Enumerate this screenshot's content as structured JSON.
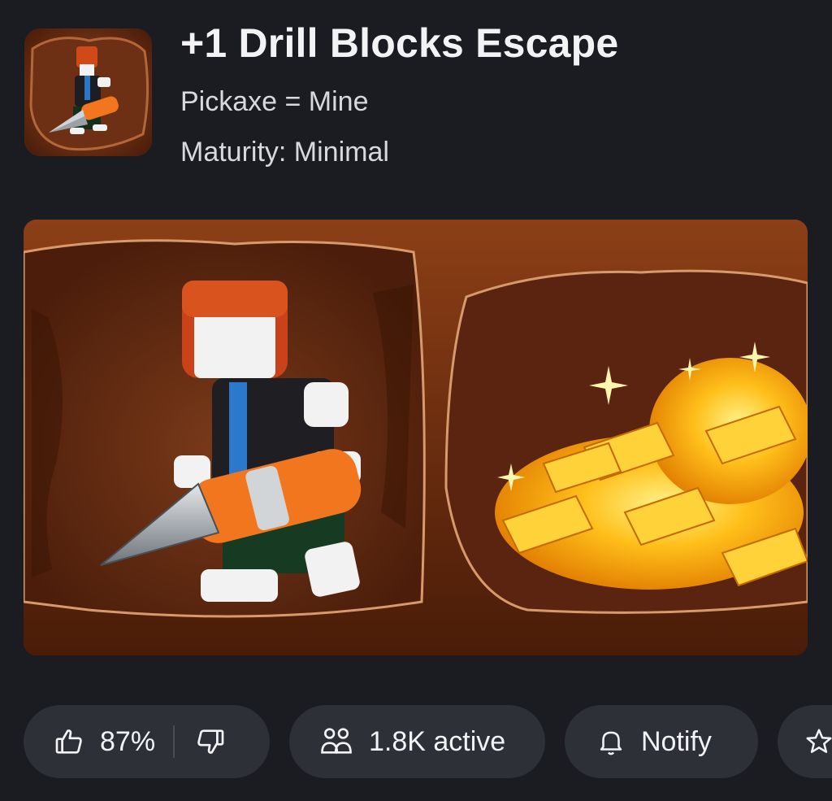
{
  "game": {
    "title": "+1 Drill Blocks Escape",
    "description": "Pickaxe = Mine",
    "maturity": "Maturity: Minimal"
  },
  "actions": {
    "rating": "87%",
    "active": "1.8K active",
    "notify": "Notify"
  },
  "icons": {
    "thumbs_up": "thumbs-up-icon",
    "thumbs_down": "thumbs-down-icon",
    "users": "users-icon",
    "bell": "bell-icon",
    "star": "star-icon"
  },
  "colors": {
    "background": "#1b1c21",
    "pill": "#2e3038",
    "text": "#f3f3f5",
    "secondary_text": "#d8d9de"
  }
}
